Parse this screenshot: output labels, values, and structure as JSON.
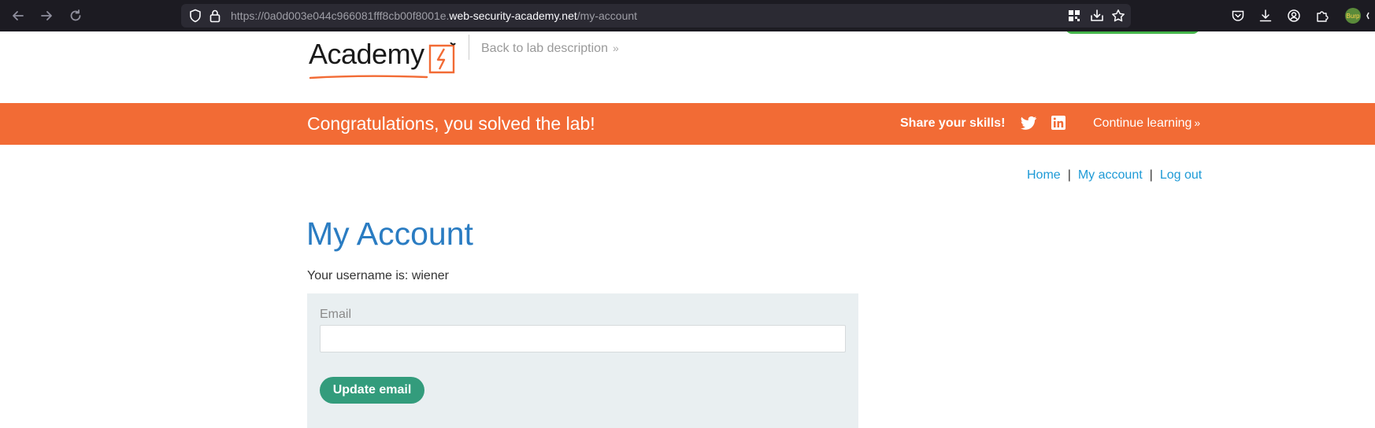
{
  "browser": {
    "url_prefix": "https://0a0d003e044c966081fff8cb00f8001e.",
    "url_host": "web-security-academy.net",
    "url_path": "/my-account",
    "extension_badge": "Burp"
  },
  "header": {
    "logo_text": "Academy",
    "back_link": "Back to lab description",
    "back_chevron": "»"
  },
  "banner": {
    "title": "Congratulations, you solved the lab!",
    "share_label": "Share your skills!",
    "continue_label": "Continue learning",
    "continue_chevron": "»"
  },
  "nav": {
    "home": "Home",
    "separator": "|",
    "my_account": "My account",
    "log_out": "Log out"
  },
  "main": {
    "title": "My Account",
    "username_text": "Your username is: wiener"
  },
  "form": {
    "email_label": "Email",
    "email_value": "",
    "button_label": "Update email"
  },
  "colors": {
    "banner": "#f26b35",
    "title": "#2a7cc2",
    "link": "#1e9ad6",
    "button": "#339c7c",
    "form_bg": "#e9eff1"
  }
}
